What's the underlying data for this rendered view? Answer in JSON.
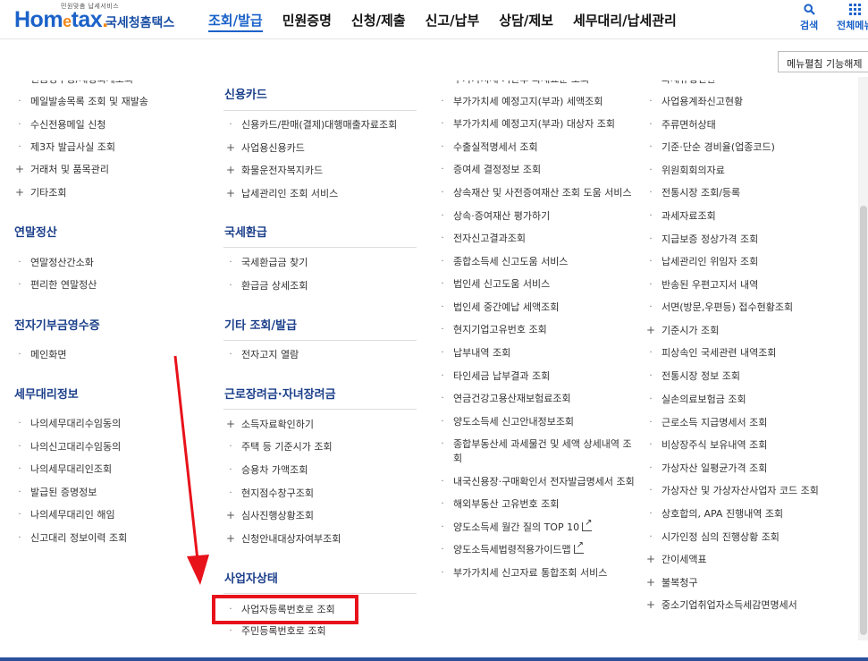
{
  "header": {
    "logo_tag": "민원맞춤 납세서비스",
    "logo_home": "Hom",
    "logo_e": "e",
    "logo_tax": "tax",
    "logo_dot": ".",
    "logo_kr": "국세청홈택스",
    "nav": [
      "조회/발급",
      "민원증명",
      "신청/제출",
      "신고/납부",
      "상담/제보",
      "세무대리/납세관리"
    ],
    "search_label": "검색",
    "allmenu_label": "전체메뉴",
    "fold_button": "메뉴펼침 기능해제"
  },
  "col1": {
    "top_items": [
      {
        "label": "현금영수증/세정회계조회",
        "type": "dot"
      },
      {
        "label": "메일발송목록 조회 및 재발송",
        "type": "dot"
      },
      {
        "label": "수신전용메일 신청",
        "type": "dot"
      },
      {
        "label": "제3자 발급사실 조회",
        "type": "dot"
      },
      {
        "label": "거래처 및 품목관리",
        "type": "plus"
      },
      {
        "label": "기타조회",
        "type": "plus"
      }
    ],
    "sections": [
      {
        "title": "연말정산",
        "items": [
          {
            "label": "연말정산간소화",
            "type": "dot"
          },
          {
            "label": "편리한 연말정산",
            "type": "dot"
          }
        ]
      },
      {
        "title": "전자기부금영수증",
        "items": [
          {
            "label": "메인화면",
            "type": "dot"
          }
        ]
      },
      {
        "title": "세무대리정보",
        "items": [
          {
            "label": "나의세무대리수임동의",
            "type": "dot"
          },
          {
            "label": "나의신고대리수임동의",
            "type": "dot"
          },
          {
            "label": "나의세무대리인조회",
            "type": "dot"
          },
          {
            "label": "발급된 증명정보",
            "type": "dot"
          },
          {
            "label": "나의세무대리인 해임",
            "type": "dot"
          },
          {
            "label": "신고대리 정보이력 조회",
            "type": "dot"
          }
        ]
      }
    ]
  },
  "col2": {
    "sections": [
      {
        "title": "신용카드",
        "items": [
          {
            "label": "신용카드/판매(결제)대행매출자료조회",
            "type": "dot"
          },
          {
            "label": "사업용신용카드",
            "type": "plus"
          },
          {
            "label": "화물운전자복지카드",
            "type": "plus"
          },
          {
            "label": "납세관리인 조회 서비스",
            "type": "plus"
          }
        ]
      },
      {
        "title": "국세환급",
        "items": [
          {
            "label": "국세환급금 찾기",
            "type": "dot"
          },
          {
            "label": "환급금 상세조회",
            "type": "dot"
          }
        ]
      },
      {
        "title": "기타 조회/발급",
        "items": [
          {
            "label": "전자고지 열람",
            "type": "dot"
          }
        ]
      },
      {
        "title": "근로장려금·자녀장려금",
        "items": [
          {
            "label": "소득자료확인하기",
            "type": "plus"
          },
          {
            "label": "주택 등 기준시가 조회",
            "type": "dot"
          },
          {
            "label": "승용차 가액조회",
            "type": "dot"
          },
          {
            "label": "현지점수창구조회",
            "type": "dot"
          },
          {
            "label": "심사진행상황조회",
            "type": "plus"
          },
          {
            "label": "신청안내대상자여부조회",
            "type": "plus"
          }
        ]
      },
      {
        "title": "사업자상태",
        "items": [
          {
            "label": "사업자등록번호로 조회",
            "type": "dot"
          },
          {
            "label": "주민등록번호로 조회",
            "type": "dot"
          }
        ]
      }
    ]
  },
  "col3": {
    "items": [
      {
        "label": "부가가치세 기한후 과세표준 조회",
        "type": "dot"
      },
      {
        "label": "부가가치세 예정고지(부과) 세액조회",
        "type": "dot"
      },
      {
        "label": "부가가치세 예정고지(부과) 대상자 조회",
        "type": "dot"
      },
      {
        "label": "수출실적명세서 조회",
        "type": "dot"
      },
      {
        "label": "증여세 결정정보 조회",
        "type": "dot"
      },
      {
        "label": "상속재산 및 사전증여재산 조회 도움 서비스",
        "type": "dot"
      },
      {
        "label": "상속·증여재산 평가하기",
        "type": "dot"
      },
      {
        "label": "전자신고결과조회",
        "type": "dot"
      },
      {
        "label": "종합소득세 신고도움 서비스",
        "type": "dot"
      },
      {
        "label": "법인세 신고도움 서비스",
        "type": "dot"
      },
      {
        "label": "법인세 중간예납 세액조회",
        "type": "dot"
      },
      {
        "label": "현지기업고유번호 조회",
        "type": "dot"
      },
      {
        "label": "납부내역 조회",
        "type": "dot"
      },
      {
        "label": "타인세금 납부결과 조회",
        "type": "dot"
      },
      {
        "label": "연금건강고용산재보험료조회",
        "type": "dot"
      },
      {
        "label": "양도소득세 신고안내정보조회",
        "type": "dot"
      },
      {
        "label": "종합부동산세 과세물건 및 세액 상세내역 조",
        "label2": "회",
        "type": "dot"
      },
      {
        "label": "내국신용장·구매확인서 전자발급명세서 조회",
        "type": "dot"
      },
      {
        "label": "해외부동산 고유번호 조회",
        "type": "dot"
      },
      {
        "label": "양도소득세 월간 질의 TOP 10",
        "type": "dot",
        "ext": true
      },
      {
        "label": "양도소득세법령적용가이드맵",
        "type": "dot",
        "ext": true
      },
      {
        "label": "부가가치세 신고자료 통합조회 서비스",
        "type": "dot"
      }
    ]
  },
  "col4": {
    "items": [
      {
        "label": "과세유형전환",
        "type": "dot"
      },
      {
        "label": "사업용계좌신고현황",
        "type": "dot"
      },
      {
        "label": "주류면허상태",
        "type": "dot"
      },
      {
        "label": "기준·단순 경비율(업종코드)",
        "type": "dot"
      },
      {
        "label": "위원회회의자료",
        "type": "dot"
      },
      {
        "label": "전통시장 조회/등록",
        "type": "dot"
      },
      {
        "label": "과세자료조회",
        "type": "dot"
      },
      {
        "label": "지급보증 정상가격 조회",
        "type": "dot"
      },
      {
        "label": "납세관리인 위임자 조회",
        "type": "dot"
      },
      {
        "label": "반송된 우편고지서 내역",
        "type": "dot"
      },
      {
        "label": "서면(방문,우편등) 접수현황조회",
        "type": "dot"
      },
      {
        "label": "기준시가 조회",
        "type": "plus"
      },
      {
        "label": "피상속인 국세관련 내역조회",
        "type": "dot"
      },
      {
        "label": "전통시장 정보 조회",
        "type": "dot"
      },
      {
        "label": "실손의료보험금 조회",
        "type": "dot"
      },
      {
        "label": "근로소득 지급명세서 조회",
        "type": "dot"
      },
      {
        "label": "비상장주식 보유내역 조회",
        "type": "dot"
      },
      {
        "label": "가상자산 일평균가격 조회",
        "type": "dot"
      },
      {
        "label": "가상자산 및 가상자산사업자 코드 조회",
        "type": "dot"
      },
      {
        "label": "상호합의, APA 진행내역 조회",
        "type": "dot"
      },
      {
        "label": "시가인정 심의 진행상황 조회",
        "type": "dot"
      },
      {
        "label": "간이세액표",
        "type": "plus"
      },
      {
        "label": "불복청구",
        "type": "plus"
      },
      {
        "label": "중소기업취업자소득세감면명세서",
        "type": "plus"
      }
    ]
  },
  "annotation": {
    "arrow_color": "#e8121a",
    "box_color": "#e8121a"
  }
}
